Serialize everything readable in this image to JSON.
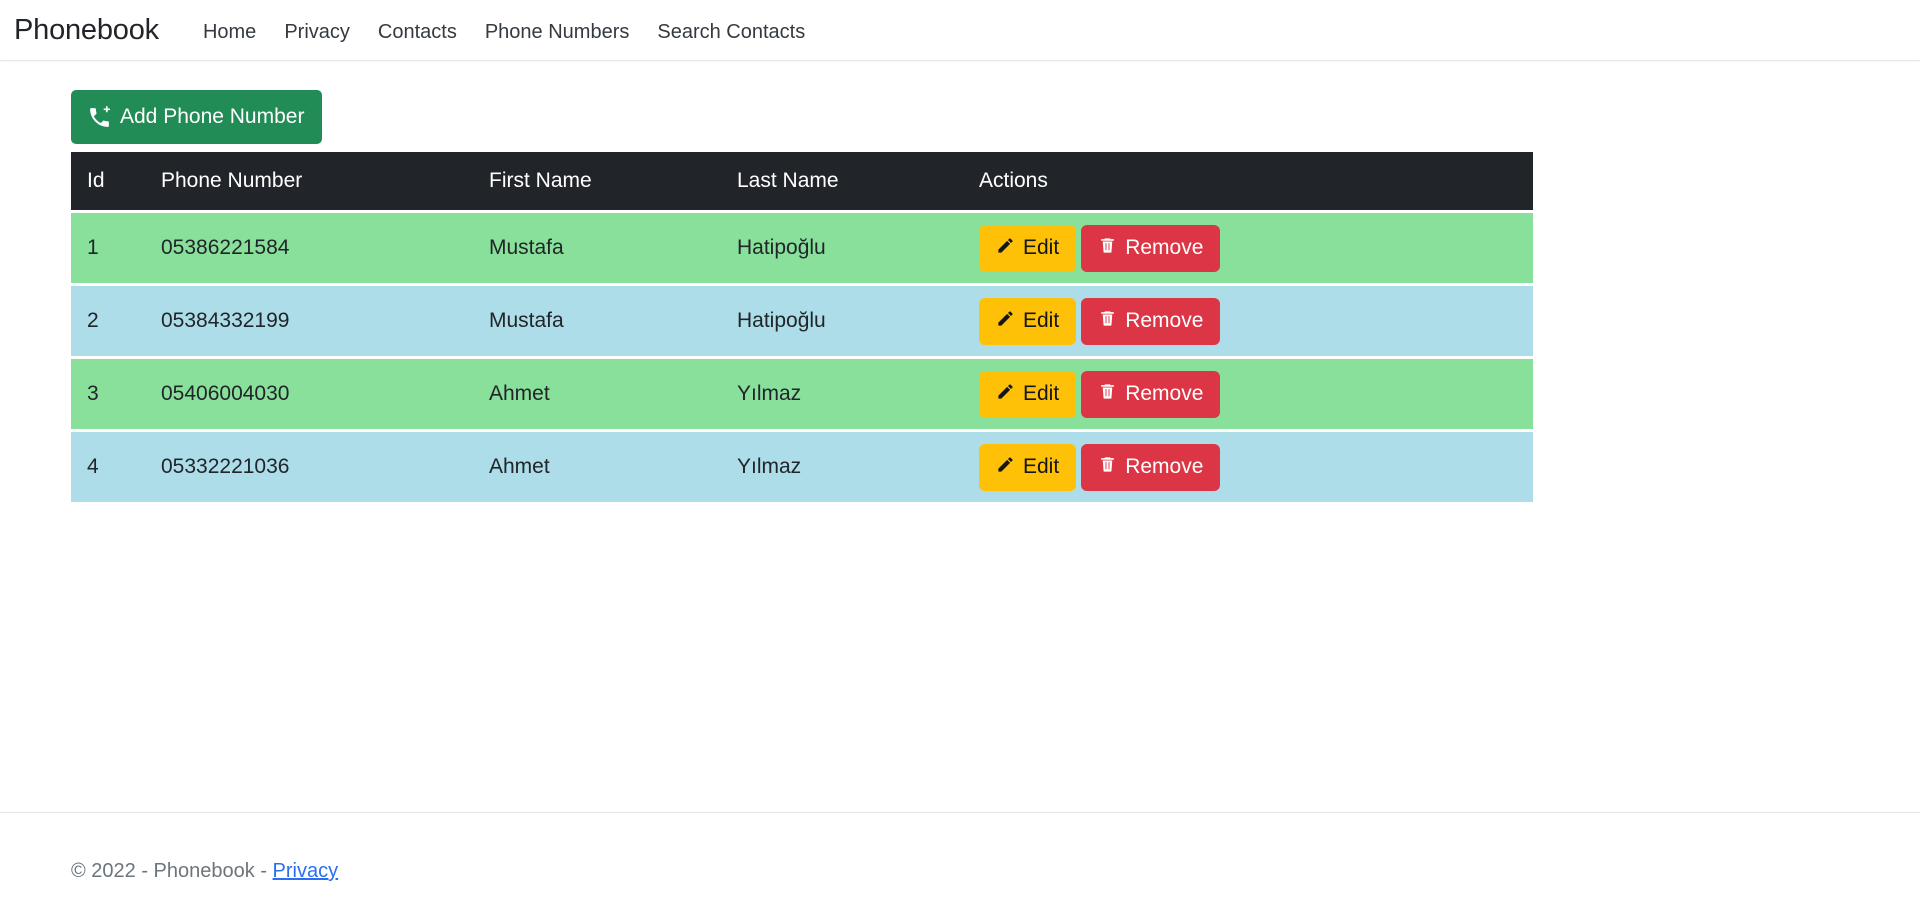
{
  "navbar": {
    "brand": "Phonebook",
    "links": [
      {
        "label": "Home"
      },
      {
        "label": "Privacy"
      },
      {
        "label": "Contacts"
      },
      {
        "label": "Phone Numbers"
      },
      {
        "label": "Search Contacts"
      }
    ]
  },
  "toolbar": {
    "add_label": "Add Phone Number",
    "add_icon": "phone-plus-icon",
    "add_bg_color": "#218c56"
  },
  "table": {
    "columns": [
      "Id",
      "Phone Number",
      "First Name",
      "Last Name",
      "Actions"
    ],
    "header_bg_color": "#212529",
    "row_colors": {
      "odd": "#88e09b",
      "even": "#addde9"
    },
    "action_labels": {
      "edit": "Edit",
      "remove": "Remove"
    },
    "action_icons": {
      "edit": "pencil-icon",
      "remove": "trash-icon"
    },
    "action_colors": {
      "edit_bg": "#ffc107",
      "edit_text": "#141619",
      "remove_bg": "#dc3545",
      "remove_text": "#ffffff"
    },
    "rows": [
      {
        "id": "1",
        "phone": "05386221584",
        "first": "Mustafa",
        "last": "Hatipoğlu"
      },
      {
        "id": "2",
        "phone": "05384332199",
        "first": "Mustafa",
        "last": "Hatipoğlu"
      },
      {
        "id": "3",
        "phone": "05406004030",
        "first": "Ahmet",
        "last": "Yılmaz"
      },
      {
        "id": "4",
        "phone": "05332221036",
        "first": "Ahmet",
        "last": "Yılmaz"
      }
    ]
  },
  "footer": {
    "copyright": "© 2022 - Phonebook - ",
    "privacy_label": "Privacy",
    "link_color": "#2a6ff2"
  }
}
